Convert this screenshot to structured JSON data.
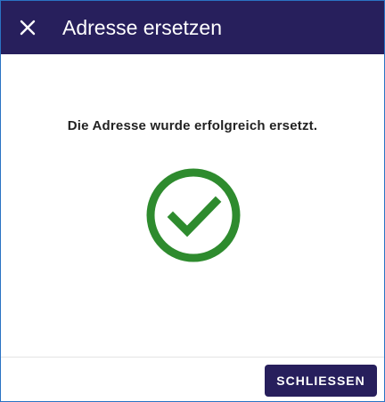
{
  "dialog": {
    "title": "Adresse ersetzen",
    "close_icon": "close-icon",
    "message": "Die Adresse wurde erfolgreich ersetzt.",
    "status_icon": "check-circle-icon",
    "close_button_label": "SCHLIESSEN"
  },
  "colors": {
    "header_bg": "#271f5c",
    "success_green": "#2e8b2e",
    "button_bg": "#271f5c",
    "border": "#2a73c4"
  }
}
